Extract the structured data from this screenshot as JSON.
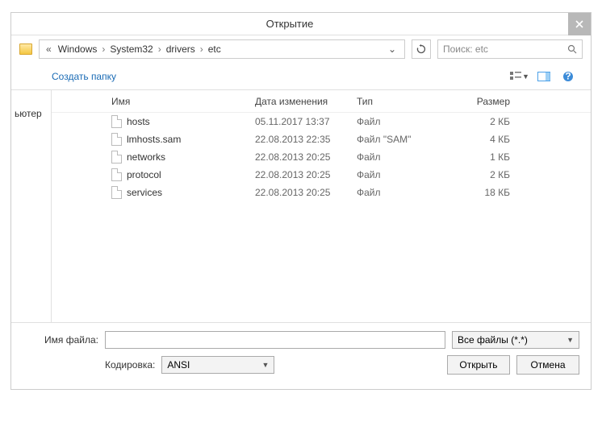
{
  "title": "Открытие",
  "breadcrumb": {
    "prefix": "«",
    "seg1": "Windows",
    "seg2": "System32",
    "seg3": "drivers",
    "seg4": "etc"
  },
  "search": {
    "placeholder": "Поиск: etc"
  },
  "toolbar": {
    "new_folder": "Создать папку"
  },
  "nav": {
    "item": "ьютер"
  },
  "columns": {
    "name": "Имя",
    "date": "Дата изменения",
    "type": "Тип",
    "size": "Размер"
  },
  "files": [
    {
      "name": "hosts",
      "date": "05.11.2017 13:37",
      "type": "Файл",
      "size": "2 КБ"
    },
    {
      "name": "lmhosts.sam",
      "date": "22.08.2013 22:35",
      "type": "Файл \"SAM\"",
      "size": "4 КБ"
    },
    {
      "name": "networks",
      "date": "22.08.2013 20:25",
      "type": "Файл",
      "size": "1 КБ"
    },
    {
      "name": "protocol",
      "date": "22.08.2013 20:25",
      "type": "Файл",
      "size": "2 КБ"
    },
    {
      "name": "services",
      "date": "22.08.2013 20:25",
      "type": "Файл",
      "size": "18 КБ"
    }
  ],
  "footer": {
    "filename_label": "Имя файла:",
    "filename_value": "",
    "filter": "Все файлы  (*.*)",
    "encoding_label": "Кодировка:",
    "encoding": "ANSI",
    "open": "Открыть",
    "cancel": "Отмена"
  }
}
